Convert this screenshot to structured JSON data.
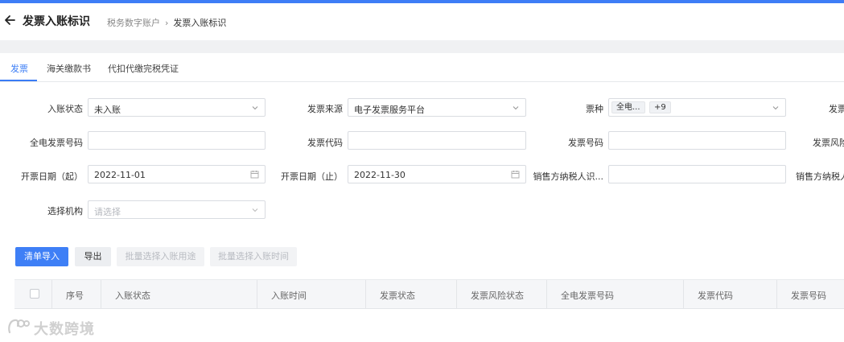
{
  "header": {
    "title": "发票入账标识",
    "breadcrumb": [
      "税务数字账户",
      "发票入账标识"
    ],
    "breadcrumb_separator": "›"
  },
  "tabs": [
    {
      "label": "发票",
      "active": true
    },
    {
      "label": "海关缴款书",
      "active": false
    },
    {
      "label": "代扣代缴完税凭证",
      "active": false
    }
  ],
  "filters": {
    "entry_status": {
      "label": "入账状态",
      "value": "未入账"
    },
    "invoice_source": {
      "label": "发票来源",
      "value": "电子发票服务平台"
    },
    "invoice_type": {
      "label": "票种",
      "tag": "全电...",
      "more": "+9"
    },
    "col4_label_1": "发票",
    "full_invoice_no": {
      "label": "全电发票号码",
      "value": ""
    },
    "invoice_code": {
      "label": "发票代码",
      "value": ""
    },
    "invoice_no": {
      "label": "发票号码",
      "value": ""
    },
    "col4_label_2": "发票风险",
    "date_from": {
      "label": "开票日期（起）",
      "value": "2022-11-01"
    },
    "date_to": {
      "label": "开票日期（止）",
      "value": "2022-11-30"
    },
    "seller_tax_id": {
      "label": "销售方纳税人识...",
      "value": ""
    },
    "col4_label_3": "销售方纳税人",
    "org": {
      "label": "选择机构",
      "placeholder": "请选择"
    }
  },
  "toolbar": {
    "import_label": "清单导入",
    "export_label": "导出",
    "batch_purpose_label": "批量选择入账用途",
    "batch_time_label": "批量选择入账时间"
  },
  "table": {
    "columns": [
      "序号",
      "入账状态",
      "入账时间",
      "发票状态",
      "发票风险状态",
      "全电发票号码",
      "发票代码",
      "发票号码"
    ]
  },
  "watermark": {
    "text": "大数跨境"
  },
  "colors": {
    "accent": "#3e7ff6",
    "tab_active": "#3a7cf5",
    "topbar": "#3e7df6"
  }
}
